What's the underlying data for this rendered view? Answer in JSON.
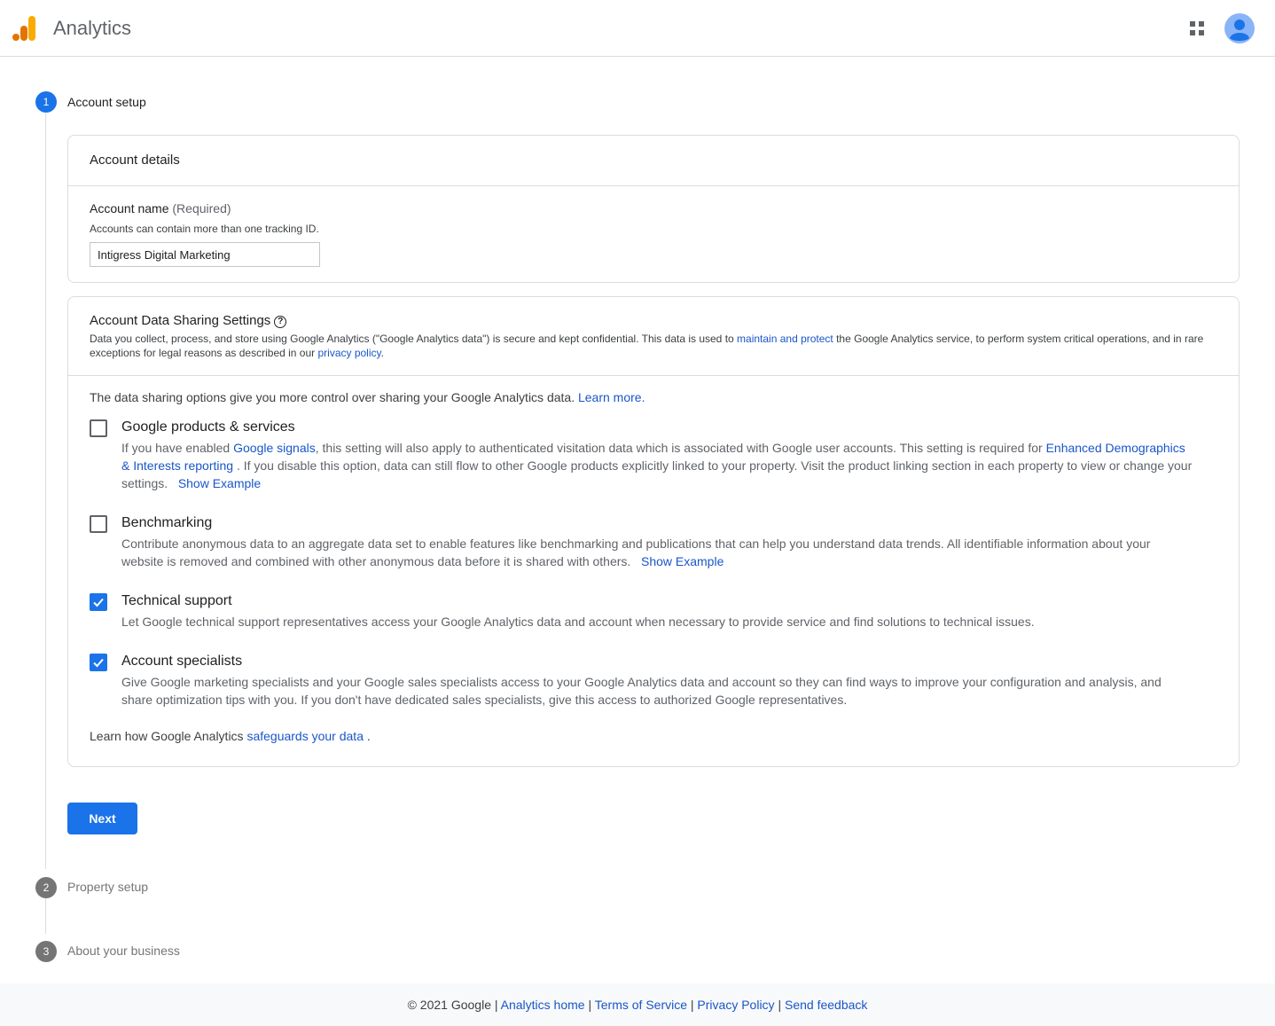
{
  "header": {
    "title": "Analytics",
    "apps_icon": "apps-grid-icon",
    "avatar_icon": "account-avatar-icon",
    "brand_colors": {
      "orange_light": "#F9AB00",
      "orange_dark": "#E37400"
    }
  },
  "stepper": {
    "steps": [
      {
        "number": "1",
        "label": "Account setup",
        "state": "active"
      },
      {
        "number": "2",
        "label": "Property setup",
        "state": "inactive"
      },
      {
        "number": "3",
        "label": "About your business",
        "state": "inactive"
      }
    ]
  },
  "account_details": {
    "title": "Account details",
    "name_label": "Account name",
    "name_required": "(Required)",
    "name_hint": "Accounts can contain more than one tracking ID.",
    "name_value": "Intigress Digital Marketing"
  },
  "sharing": {
    "title": "Account Data Sharing Settings",
    "help_icon": "help-circle-icon",
    "desc_1": "Data you collect, process, and store using Google Analytics (\"Google Analytics data\") is secure and kept confidential. This data is used to ",
    "desc_link_1": "maintain and protect",
    "desc_2": " the Google Analytics service, to perform system critical operations, and in rare exceptions for legal reasons as described in our ",
    "desc_link_2": "privacy policy",
    "desc_3": ".",
    "intro": "The data sharing options give you more control over sharing your Google Analytics data. ",
    "intro_link": "Learn more.",
    "options": [
      {
        "title": "Google products & services",
        "checked": false,
        "d1": "If you have enabled ",
        "l1": "Google signals",
        "d2": ", this setting will also apply to authenticated visitation data which is associated with Google user accounts. This setting is required for ",
        "l2": "Enhanced Demographics & Interests reporting",
        "d3": " . If you disable this option, data can still flow to other Google products explicitly linked to your property. Visit the product linking section in each property to view or change your settings.",
        "example": "Show Example"
      },
      {
        "title": "Benchmarking",
        "checked": false,
        "d1": "Contribute anonymous data to an aggregate data set to enable features like benchmarking and publications that can help you understand data trends. All identifiable information about your website is removed and combined with other anonymous data before it is shared with others.",
        "example": "Show Example"
      },
      {
        "title": "Technical support",
        "checked": true,
        "d1": "Let Google technical support representatives access your Google Analytics data and account when necessary to provide service and find solutions to technical issues."
      },
      {
        "title": "Account specialists",
        "checked": true,
        "d1": "Give Google marketing specialists and your Google sales specialists access to your Google Analytics data and account so they can find ways to improve your configuration and analysis, and share optimization tips with you. If you don't have dedicated sales specialists, give this access to authorized Google representatives."
      }
    ],
    "safeguards_1": "Learn how Google Analytics ",
    "safeguards_link": "safeguards your data",
    "safeguards_2": " ."
  },
  "next_button": "Next",
  "footer": {
    "copyright": "© 2021 Google",
    "sep": " | ",
    "links": [
      "Analytics home",
      "Terms of Service",
      "Privacy Policy",
      "Send feedback"
    ]
  }
}
